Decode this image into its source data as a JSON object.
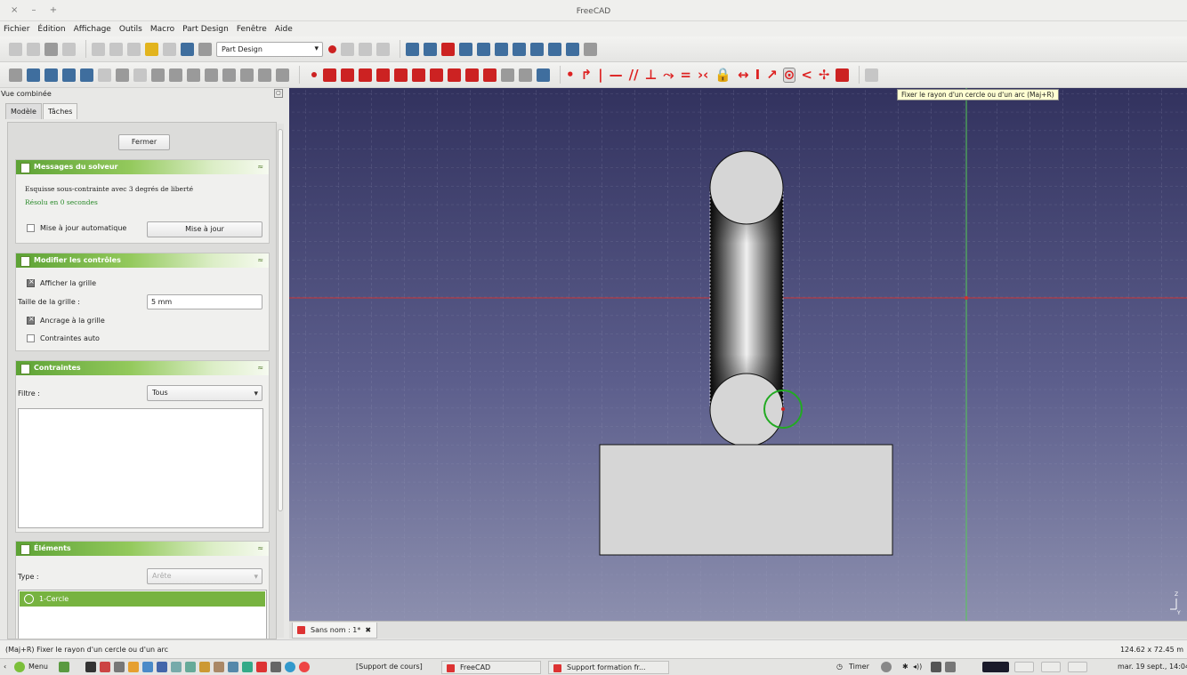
{
  "window": {
    "title": "FreeCAD",
    "controls": "× – +"
  },
  "menu": [
    "Fichier",
    "Édition",
    "Affichage",
    "Outils",
    "Macro",
    "Part Design",
    "Fenêtre",
    "Aide"
  ],
  "toolbar": {
    "workbench": "Part Design"
  },
  "tooltip": "Fixer le rayon d'un cercle ou d'un arc (Maj+R)",
  "combo": {
    "title": "Vue combinée",
    "tabs": [
      "Modèle",
      "Tâches"
    ],
    "active_tab": "Tâches"
  },
  "tasks": {
    "close_label": "Fermer",
    "solver": {
      "title": "Messages du solveur",
      "message": "Esquisse sous-contrainte avec 3 degrés de liberté",
      "solved": "Résolu en 0 secondes",
      "auto_update_label": "Mise à jour automatique",
      "auto_update_checked": false,
      "update_button": "Mise à jour"
    },
    "controls": {
      "title": "Modifier les contrôles",
      "show_grid_label": "Afficher la grille",
      "show_grid_checked": true,
      "grid_size_label": "Taille de la grille :",
      "grid_size_value": "5 mm",
      "snap_label": "Ancrage à la grille",
      "snap_checked": true,
      "auto_constraints_label": "Contraintes auto",
      "auto_constraints_checked": false
    },
    "constraints": {
      "title": "Contraintes",
      "filter_label": "Filtre :",
      "filter_value": "Tous"
    },
    "elements": {
      "title": "Éléments",
      "type_label": "Type :",
      "type_value": "Arête",
      "selected_item": "1-Cercle"
    }
  },
  "document_tab": {
    "label": "Sans nom : 1*",
    "close": "✖"
  },
  "viewport": {
    "axis_x_color": "#cc3333",
    "axis_y_color": "#55cc55",
    "selection_color": "#22aa22",
    "axis_labels": [
      "Z",
      "Y"
    ]
  },
  "statusbar": {
    "left": "(Maj+R) Fixer le rayon d'un cercle ou d'un arc",
    "right": "124.62 x 72.45 m"
  },
  "taskbar": {
    "menu_label": "Menu",
    "windows": [
      "[Support de cours]",
      "FreeCAD",
      "Support formation fr..."
    ],
    "timer": "Timer",
    "clock": "mar. 19 sept., 14:04"
  }
}
